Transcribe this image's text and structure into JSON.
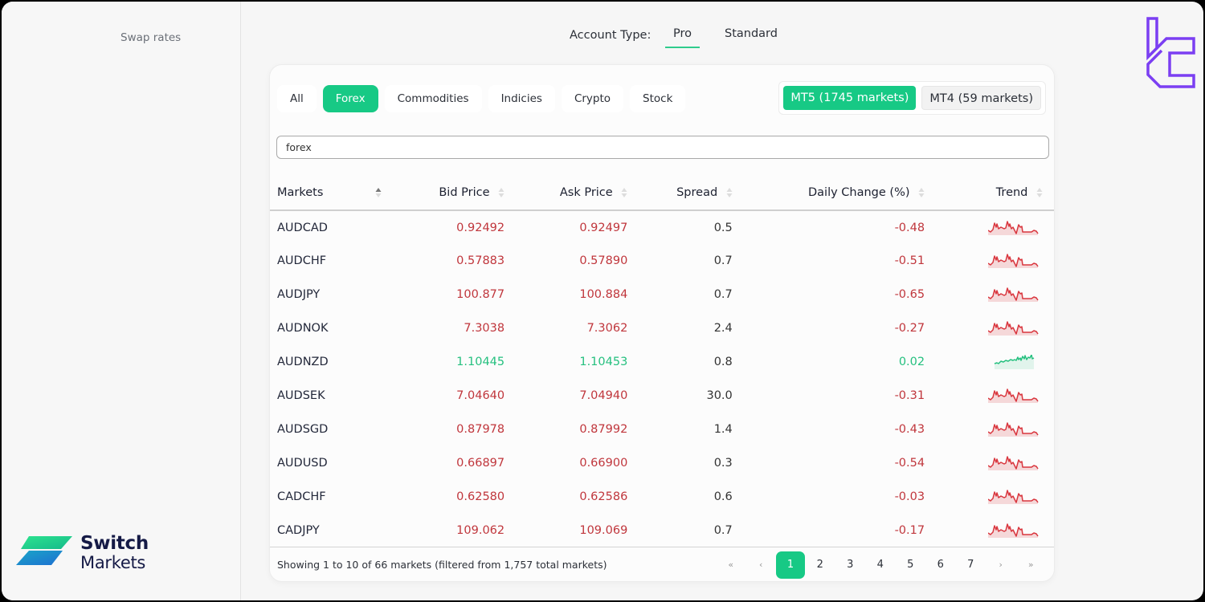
{
  "sidebar": {
    "swap_rates_label": "Swap rates"
  },
  "brand": {
    "line1": "Switch",
    "line2": "Markets"
  },
  "account_type": {
    "label": "Account Type:",
    "options": [
      "Pro",
      "Standard"
    ],
    "selected": "Pro"
  },
  "categories": [
    "All",
    "Forex",
    "Commodities",
    "Indicies",
    "Crypto",
    "Stock"
  ],
  "active_category": "Forex",
  "platforms": [
    {
      "label": "MT5 (1745 markets)",
      "active": true
    },
    {
      "label": "MT4 (59 markets)",
      "active": false
    }
  ],
  "search": {
    "value": "forex"
  },
  "table": {
    "headers": [
      "Markets",
      "Bid Price",
      "Ask Price",
      "Spread",
      "Daily Change (%)",
      "Trend"
    ],
    "rows": [
      {
        "market": "AUDCAD",
        "bid": "0.92492",
        "ask": "0.92497",
        "spread": "0.5",
        "change": "-0.48",
        "direction": "down"
      },
      {
        "market": "AUDCHF",
        "bid": "0.57883",
        "ask": "0.57890",
        "spread": "0.7",
        "change": "-0.51",
        "direction": "down"
      },
      {
        "market": "AUDJPY",
        "bid": "100.877",
        "ask": "100.884",
        "spread": "0.7",
        "change": "-0.65",
        "direction": "down"
      },
      {
        "market": "AUDNOK",
        "bid": "7.3038",
        "ask": "7.3062",
        "spread": "2.4",
        "change": "-0.27",
        "direction": "down"
      },
      {
        "market": "AUDNZD",
        "bid": "1.10445",
        "ask": "1.10453",
        "spread": "0.8",
        "change": "0.02",
        "direction": "up"
      },
      {
        "market": "AUDSEK",
        "bid": "7.04640",
        "ask": "7.04940",
        "spread": "30.0",
        "change": "-0.31",
        "direction": "down"
      },
      {
        "market": "AUDSGD",
        "bid": "0.87978",
        "ask": "0.87992",
        "spread": "1.4",
        "change": "-0.43",
        "direction": "down"
      },
      {
        "market": "AUDUSD",
        "bid": "0.66897",
        "ask": "0.66900",
        "spread": "0.3",
        "change": "-0.54",
        "direction": "down"
      },
      {
        "market": "CADCHF",
        "bid": "0.62580",
        "ask": "0.62586",
        "spread": "0.6",
        "change": "-0.03",
        "direction": "down"
      },
      {
        "market": "CADJPY",
        "bid": "109.062",
        "ask": "109.069",
        "spread": "0.7",
        "change": "-0.17",
        "direction": "down"
      }
    ]
  },
  "footer": {
    "info": "Showing 1 to 10 of 66 markets (filtered from 1,757 total markets)",
    "pagination": {
      "first": "«",
      "prev": "‹",
      "pages": [
        "1",
        "2",
        "3",
        "4",
        "5",
        "6",
        "7"
      ],
      "current": "1",
      "next": "›",
      "last": "»"
    }
  },
  "colors": {
    "accent": "#17c985",
    "negative": "#c0363c",
    "positive": "#25c07f",
    "logo_purple": "#7b3ff2"
  }
}
